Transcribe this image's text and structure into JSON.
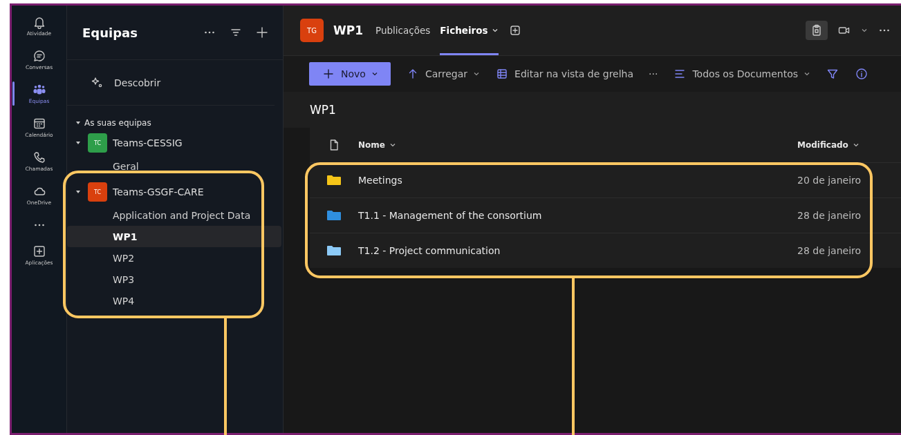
{
  "rail": {
    "items": [
      {
        "kind": "bell",
        "label": "Atividade",
        "selected": false
      },
      {
        "kind": "chat",
        "label": "Conversas",
        "selected": false
      },
      {
        "kind": "teams",
        "label": "Equipas",
        "selected": true
      },
      {
        "kind": "calendar",
        "label": "Calendário",
        "selected": false
      },
      {
        "kind": "call",
        "label": "Chamadas",
        "selected": false
      },
      {
        "kind": "cloud",
        "label": "OneDrive",
        "selected": false
      },
      {
        "kind": "more",
        "selected": false
      },
      {
        "kind": "apps",
        "label": "Aplicações",
        "selected": false
      }
    ]
  },
  "teams_panel": {
    "title": "Equipas",
    "discover": "Descobrir",
    "section": {
      "label": "As suas equipas",
      "expanded": true
    },
    "teams": [
      {
        "name": "Teams-CESSIG",
        "avatar": "TC",
        "color": "#2e9e4a",
        "expanded": true,
        "channels": [
          {
            "name": "Geral",
            "selected": false
          }
        ]
      },
      {
        "name": "Teams-GSGF-CARE",
        "avatar": "TC",
        "color": "#d9400e",
        "expanded": true,
        "channels": [
          {
            "name": "Application and Project Data",
            "selected": false
          },
          {
            "name": "WP1",
            "selected": true
          },
          {
            "name": "WP2",
            "selected": false
          },
          {
            "name": "WP3",
            "selected": false
          },
          {
            "name": "WP4",
            "selected": false
          }
        ]
      }
    ]
  },
  "channel_header": {
    "avatar": "TG",
    "title": "WP1",
    "tabs": [
      {
        "label": "Publicações",
        "selected": false,
        "dropdown": false
      },
      {
        "label": "Ficheiros",
        "selected": true,
        "dropdown": true
      }
    ]
  },
  "toolbar": {
    "new_button": "Novo",
    "upload": "Carregar",
    "grid_edit": "Editar na vista de grelha",
    "more": "···",
    "view": "Todos os Documentos"
  },
  "library": {
    "title": "WP1",
    "columns": [
      "Nome",
      "Modificado"
    ],
    "rows": [
      {
        "name": "Meetings",
        "modified": "20 de janeiro",
        "color": "#f5c518"
      },
      {
        "name": "T1.1 - Management of the consortium",
        "modified": "28 de janeiro",
        "color": "#2f8fe0"
      },
      {
        "name": "T1.2 - Project communication",
        "modified": "28 de janeiro",
        "color": "#8ccaf7"
      }
    ]
  }
}
